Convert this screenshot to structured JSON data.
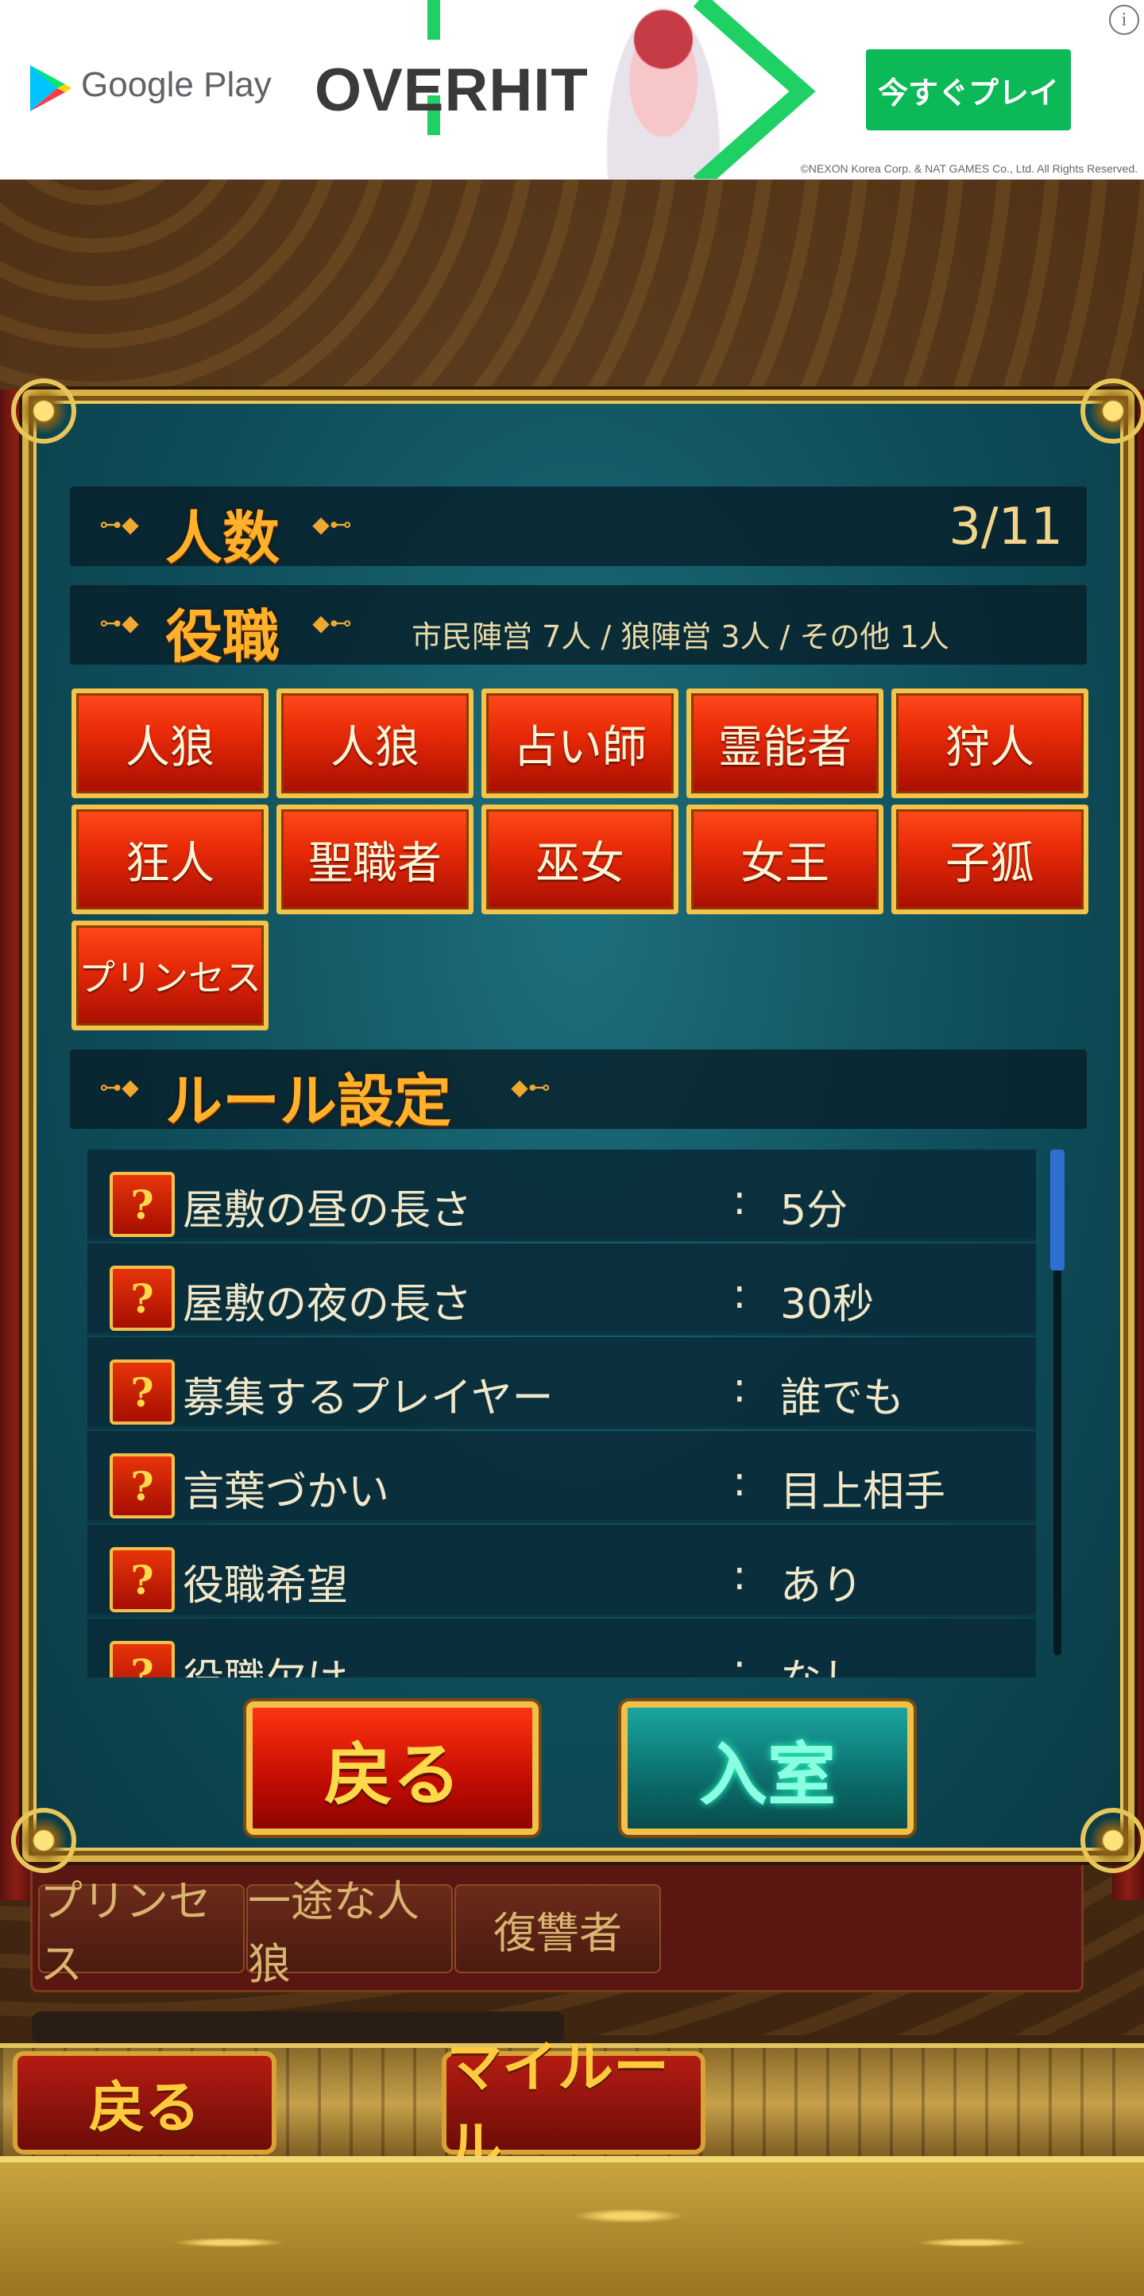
{
  "ad": {
    "store_name": "Google Play",
    "game_title": "OVERHIT",
    "cta_label": "今すぐプレイ",
    "info_symbol": "i",
    "copyright": "©NEXON Korea Corp. & NAT GAMES Co., Ltd. All Rights Reserved."
  },
  "dialog": {
    "count_section": {
      "title": "人数",
      "value": "3/11"
    },
    "role_section": {
      "title": "役職",
      "summary": "市民陣営 7人 / 狼陣営 3人 / その他 1人",
      "roles": [
        "人狼",
        "人狼",
        "占い師",
        "霊能者",
        "狩人",
        "狂人",
        "聖職者",
        "巫女",
        "女王",
        "子狐",
        "プリンセス"
      ]
    },
    "rules_section": {
      "title": "ルール設定",
      "help_symbol": "?",
      "separator": ":",
      "rules": [
        {
          "label": "屋敷の昼の長さ",
          "value": "5分"
        },
        {
          "label": "屋敷の夜の長さ",
          "value": "30秒"
        },
        {
          "label": "募集するプレイヤー",
          "value": "誰でも"
        },
        {
          "label": "言葉づかい",
          "value": "目上相手"
        },
        {
          "label": "役職希望",
          "value": "あり"
        },
        {
          "label": "役職欠け",
          "value": "なし"
        }
      ]
    },
    "back_label": "戻る",
    "enter_label": "入室"
  },
  "background": {
    "visible_roles": [
      "プリンセス",
      "一途な人狼",
      "復讐者"
    ]
  },
  "footer": {
    "back_label": "戻る",
    "my_rule_label": "マイルール"
  },
  "colors": {
    "accent_gold": "#f3c44a",
    "role_red": "#e82a08",
    "panel_teal": "#0f4d5a",
    "ad_green": "#0bb957"
  }
}
